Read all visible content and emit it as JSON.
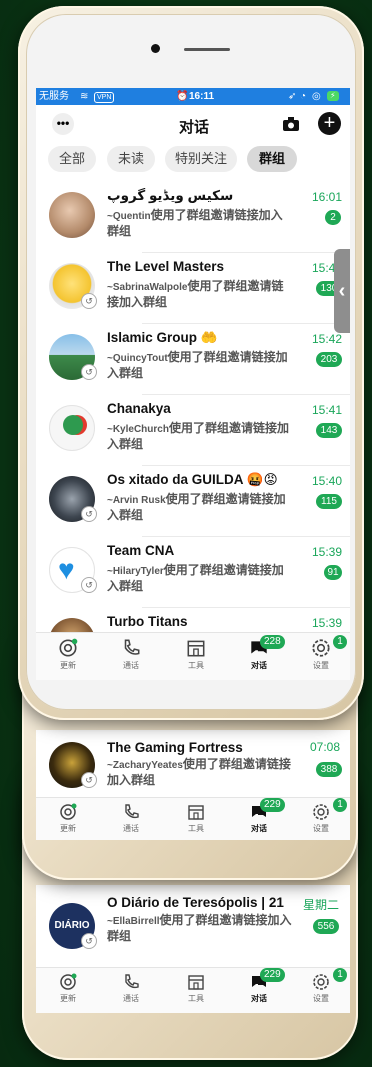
{
  "status_bar": {
    "carrier": "无服务",
    "vpn": "VPN",
    "time": "16:11",
    "battery": "⚡"
  },
  "header": {
    "title": "对话",
    "more_icon": "more-icon",
    "camera_icon": "camera-icon",
    "add_icon": "plus-icon"
  },
  "filters": [
    {
      "label": "全部",
      "active": false
    },
    {
      "label": "未读",
      "active": false
    },
    {
      "label": "特别关注",
      "active": false
    },
    {
      "label": "群组",
      "active": true
    }
  ],
  "chats": [
    {
      "name": "سكيس ويڈيو گروپ",
      "msg_user": "~Quentin",
      "msg": "使用了群组邀请链接加入群组",
      "time": "16:01",
      "unread": "2"
    },
    {
      "name": "The Level Masters",
      "msg_user": "~SabrinaWalpole",
      "msg": "使用了群组邀请链接加入群组",
      "time": "15:4",
      "unread": "130"
    },
    {
      "name": "Islamic Group 🤲",
      "msg_user": "~QuincyTout",
      "msg": "使用了群组邀请链接加入群组",
      "time": "15:42",
      "unread": "203"
    },
    {
      "name": "Chanakya",
      "msg_user": "~KyleChurch",
      "msg": "使用了群组邀请链接加入群组",
      "time": "15:41",
      "unread": "143"
    },
    {
      "name": "Os xitado da GUILDA 🤬😡",
      "msg_user": "~Arvin Rusk",
      "msg": "使用了群组邀请链接加入群组",
      "time": "15:40",
      "unread": "115"
    },
    {
      "name": "Team CNA",
      "msg_user": "~HilaryTyler",
      "msg": "使用了群组邀请链接加入群组",
      "time": "15:39",
      "unread": "91"
    },
    {
      "name": "Turbo Titans",
      "time": "15:39"
    }
  ],
  "tabbar": {
    "tabs": [
      {
        "label": "更新",
        "icon": "updates-icon"
      },
      {
        "label": "通话",
        "icon": "phone-icon"
      },
      {
        "label": "工具",
        "icon": "store-icon"
      },
      {
        "label": "对话",
        "icon": "chats-icon",
        "active": true
      },
      {
        "label": "设置",
        "icon": "settings-icon"
      }
    ],
    "chats_badge": "228",
    "settings_badge": "1"
  },
  "card2": {
    "chat": {
      "name": "The Gaming Fortress",
      "msg_user": "~ZacharyYeates",
      "msg": "使用了群组邀请链接加入群组",
      "time": "07:08",
      "unread": "388"
    },
    "chats_badge": "229",
    "settings_badge": "1"
  },
  "card3": {
    "chat": {
      "name": "O Diário de Teresópolis | 21",
      "msg_user": "~EllaBirrell",
      "msg": "使用了群组邀请链接加入群组",
      "time": "星期二",
      "unread": "556",
      "avatar_text": "DIÁRIO"
    },
    "chats_badge": "229",
    "settings_badge": "1"
  },
  "colors": {
    "accent": "#1fa855",
    "status_bar": "#1f7fe0",
    "frame": "#e9dcc2",
    "background": "#0a3514"
  }
}
